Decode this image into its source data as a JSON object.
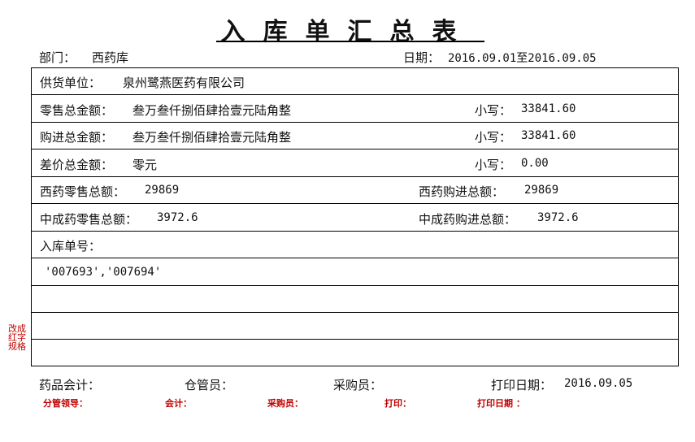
{
  "title": "入库单汇总表",
  "header": {
    "dept_label": "部门：",
    "dept_value": "西药库",
    "date_label": "日期：",
    "date_value": "2016.09.01至2016.09.05"
  },
  "rows": {
    "supplier": {
      "label": "供货单位：",
      "value": "泉州鹭燕医药有限公司"
    },
    "retail_total": {
      "label": "零售总金额：",
      "value": "叁万叁仟捌佰肆拾壹元陆角整",
      "small_label": "小写：",
      "small_value": "33841.60"
    },
    "purchase_total": {
      "label": "购进总金额：",
      "value": "叁万叁仟捌佰肆拾壹元陆角整",
      "small_label": "小写：",
      "small_value": "33841.60"
    },
    "diff_total": {
      "label": "差价总金额：",
      "value": "零元",
      "small_label": "小写：",
      "small_value": "0.00"
    },
    "western": {
      "retail_label": "西药零售总额：",
      "retail_value": "29869",
      "purchase_label": "西药购进总额：",
      "purchase_value": "29869"
    },
    "chinese": {
      "retail_label": "中成药零售总额：",
      "retail_value": "3972.6",
      "purchase_label": "中成药购进总额：",
      "purchase_value": "3972.6"
    },
    "order_no": {
      "label": "入库单号：",
      "value": "'007693','007694'"
    }
  },
  "side_note": "改成红字规格",
  "footer": {
    "accountant_label": "药品会计：",
    "warehouse_label": "仓管员：",
    "buyer_label": "采购员：",
    "print_date_label": "打印日期：",
    "print_date_value": "2016.09.05"
  },
  "footer_red": {
    "leader": "分管领导：",
    "accountant": "会计：",
    "buyer": "采购员：",
    "print": "打印：",
    "print_date": "打印日期  ："
  }
}
